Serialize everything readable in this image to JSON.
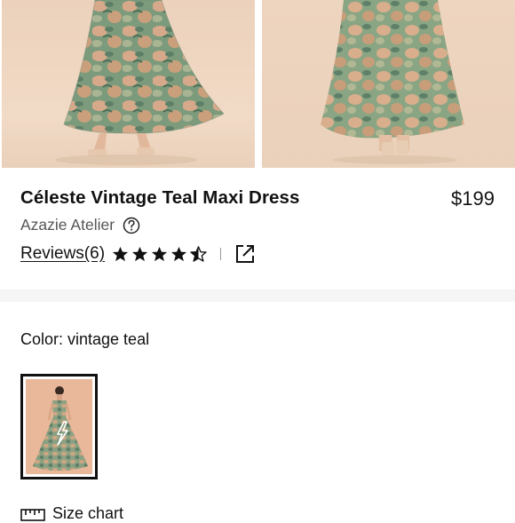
{
  "gallery": {
    "images": [
      {
        "name": "dress-front-view",
        "alt": "Céleste Vintage Teal Maxi Dress front"
      },
      {
        "name": "dress-back-view",
        "alt": "Céleste Vintage Teal Maxi Dress back"
      }
    ]
  },
  "product": {
    "title": "Céleste Vintage Teal Maxi Dress",
    "price": "$199",
    "brand": "Azazie Atelier",
    "reviews_label": "Reviews(6)",
    "rating": 4.5,
    "rating_max": 5
  },
  "color": {
    "label": "Color: vintage teal",
    "selected_swatch": "vintage teal"
  },
  "size_chart": {
    "label": "Size chart"
  },
  "colors": {
    "background": "#f3ddc8",
    "accent": "#111111",
    "muted": "#555555",
    "band": "#f5f5f5"
  },
  "icons": {
    "help": "question-circle-icon",
    "share": "external-link-icon",
    "ruler": "ruler-icon",
    "star": "star-icon"
  }
}
